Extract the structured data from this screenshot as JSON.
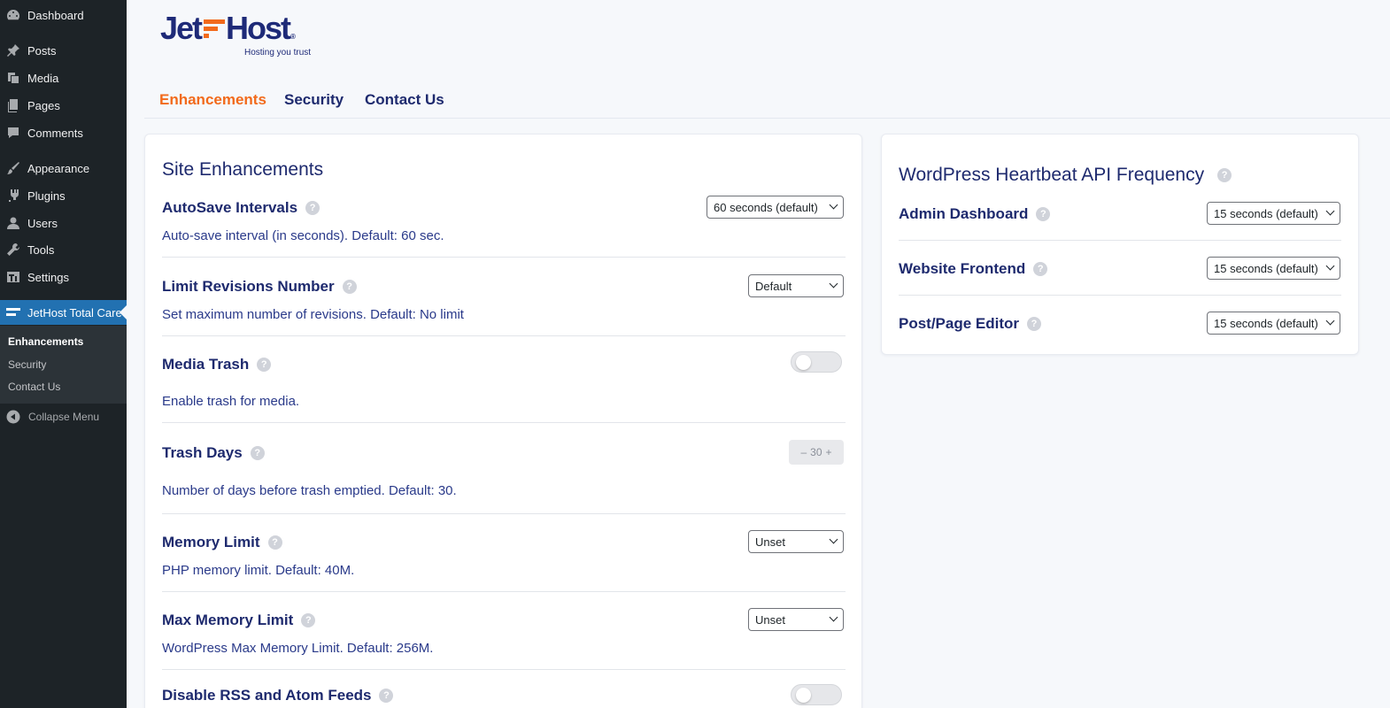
{
  "sidebar": {
    "items": [
      {
        "label": "Dashboard",
        "icon": "dashboard-icon"
      },
      {
        "label": "Posts",
        "icon": "pin-icon"
      },
      {
        "label": "Media",
        "icon": "media-icon"
      },
      {
        "label": "Pages",
        "icon": "pages-icon"
      },
      {
        "label": "Comments",
        "icon": "comment-icon"
      },
      {
        "label": "Appearance",
        "icon": "brush-icon"
      },
      {
        "label": "Plugins",
        "icon": "plug-icon"
      },
      {
        "label": "Users",
        "icon": "user-icon"
      },
      {
        "label": "Tools",
        "icon": "wrench-icon"
      },
      {
        "label": "Settings",
        "icon": "settings-icon"
      },
      {
        "label": "JetHost Total Care",
        "icon": "jethost-icon"
      }
    ],
    "submenu": [
      "Enhancements",
      "Security",
      "Contact Us"
    ],
    "collapse_label": "Collapse Menu"
  },
  "logo": {
    "left": "Jet",
    "right": "Host",
    "reg": "®",
    "tagline": "Hosting you trust",
    "colors": {
      "navy": "#1e2a78",
      "orange": "#f26a1b"
    }
  },
  "tabs": [
    "Enhancements",
    "Security",
    "Contact Us"
  ],
  "main": {
    "title": "Site Enhancements",
    "rows": [
      {
        "label": "AutoSave Intervals",
        "desc": "Auto-save interval (in seconds). Default: 60 sec.",
        "control": "select",
        "value": "60 seconds (default)"
      },
      {
        "label": "Limit Revisions Number",
        "desc": "Set maximum number of revisions. Default: No limit",
        "control": "select",
        "value": "Default"
      },
      {
        "label": "Media Trash",
        "desc": "Enable trash for media.",
        "control": "toggle",
        "value": "off"
      },
      {
        "label": "Trash Days",
        "desc": "Number of days before trash emptied. Default: 30.",
        "control": "stepper",
        "value": "30",
        "minus": "–",
        "plus": "+"
      },
      {
        "label": "Memory Limit",
        "desc": "PHP memory limit. Default: 40M.",
        "control": "select",
        "value": "Unset"
      },
      {
        "label": "Max Memory Limit",
        "desc": "WordPress Max Memory Limit. Default: 256M.",
        "control": "select",
        "value": "Unset"
      },
      {
        "label": "Disable RSS and Atom Feeds",
        "desc": "",
        "control": "toggle",
        "value": "off"
      }
    ]
  },
  "heartbeat": {
    "title": "WordPress Heartbeat API Frequency",
    "rows": [
      {
        "label": "Admin Dashboard",
        "value": "15 seconds (default)"
      },
      {
        "label": "Website Frontend",
        "value": "15 seconds (default)"
      },
      {
        "label": "Post/Page Editor",
        "value": "15 seconds (default)"
      }
    ]
  },
  "help_glyph": "?"
}
